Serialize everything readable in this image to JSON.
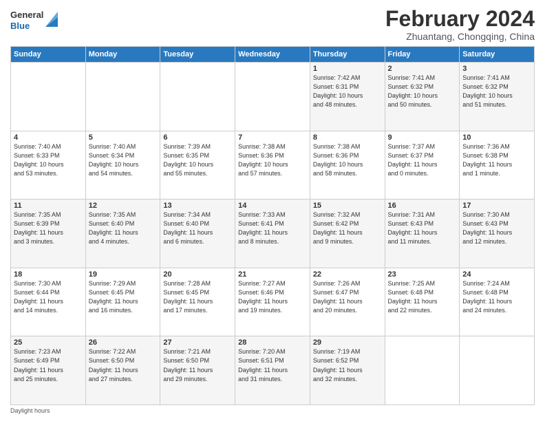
{
  "header": {
    "logo": {
      "general": "General",
      "blue": "Blue"
    },
    "title": "February 2024",
    "location": "Zhuantang, Chongqing, China"
  },
  "days_of_week": [
    "Sunday",
    "Monday",
    "Tuesday",
    "Wednesday",
    "Thursday",
    "Friday",
    "Saturday"
  ],
  "weeks": [
    [
      {
        "day": "",
        "info": ""
      },
      {
        "day": "",
        "info": ""
      },
      {
        "day": "",
        "info": ""
      },
      {
        "day": "",
        "info": ""
      },
      {
        "day": "1",
        "info": "Sunrise: 7:42 AM\nSunset: 6:31 PM\nDaylight: 10 hours\nand 48 minutes."
      },
      {
        "day": "2",
        "info": "Sunrise: 7:41 AM\nSunset: 6:32 PM\nDaylight: 10 hours\nand 50 minutes."
      },
      {
        "day": "3",
        "info": "Sunrise: 7:41 AM\nSunset: 6:32 PM\nDaylight: 10 hours\nand 51 minutes."
      }
    ],
    [
      {
        "day": "4",
        "info": "Sunrise: 7:40 AM\nSunset: 6:33 PM\nDaylight: 10 hours\nand 53 minutes."
      },
      {
        "day": "5",
        "info": "Sunrise: 7:40 AM\nSunset: 6:34 PM\nDaylight: 10 hours\nand 54 minutes."
      },
      {
        "day": "6",
        "info": "Sunrise: 7:39 AM\nSunset: 6:35 PM\nDaylight: 10 hours\nand 55 minutes."
      },
      {
        "day": "7",
        "info": "Sunrise: 7:38 AM\nSunset: 6:36 PM\nDaylight: 10 hours\nand 57 minutes."
      },
      {
        "day": "8",
        "info": "Sunrise: 7:38 AM\nSunset: 6:36 PM\nDaylight: 10 hours\nand 58 minutes."
      },
      {
        "day": "9",
        "info": "Sunrise: 7:37 AM\nSunset: 6:37 PM\nDaylight: 11 hours\nand 0 minutes."
      },
      {
        "day": "10",
        "info": "Sunrise: 7:36 AM\nSunset: 6:38 PM\nDaylight: 11 hours\nand 1 minute."
      }
    ],
    [
      {
        "day": "11",
        "info": "Sunrise: 7:35 AM\nSunset: 6:39 PM\nDaylight: 11 hours\nand 3 minutes."
      },
      {
        "day": "12",
        "info": "Sunrise: 7:35 AM\nSunset: 6:40 PM\nDaylight: 11 hours\nand 4 minutes."
      },
      {
        "day": "13",
        "info": "Sunrise: 7:34 AM\nSunset: 6:40 PM\nDaylight: 11 hours\nand 6 minutes."
      },
      {
        "day": "14",
        "info": "Sunrise: 7:33 AM\nSunset: 6:41 PM\nDaylight: 11 hours\nand 8 minutes."
      },
      {
        "day": "15",
        "info": "Sunrise: 7:32 AM\nSunset: 6:42 PM\nDaylight: 11 hours\nand 9 minutes."
      },
      {
        "day": "16",
        "info": "Sunrise: 7:31 AM\nSunset: 6:43 PM\nDaylight: 11 hours\nand 11 minutes."
      },
      {
        "day": "17",
        "info": "Sunrise: 7:30 AM\nSunset: 6:43 PM\nDaylight: 11 hours\nand 12 minutes."
      }
    ],
    [
      {
        "day": "18",
        "info": "Sunrise: 7:30 AM\nSunset: 6:44 PM\nDaylight: 11 hours\nand 14 minutes."
      },
      {
        "day": "19",
        "info": "Sunrise: 7:29 AM\nSunset: 6:45 PM\nDaylight: 11 hours\nand 16 minutes."
      },
      {
        "day": "20",
        "info": "Sunrise: 7:28 AM\nSunset: 6:45 PM\nDaylight: 11 hours\nand 17 minutes."
      },
      {
        "day": "21",
        "info": "Sunrise: 7:27 AM\nSunset: 6:46 PM\nDaylight: 11 hours\nand 19 minutes."
      },
      {
        "day": "22",
        "info": "Sunrise: 7:26 AM\nSunset: 6:47 PM\nDaylight: 11 hours\nand 20 minutes."
      },
      {
        "day": "23",
        "info": "Sunrise: 7:25 AM\nSunset: 6:48 PM\nDaylight: 11 hours\nand 22 minutes."
      },
      {
        "day": "24",
        "info": "Sunrise: 7:24 AM\nSunset: 6:48 PM\nDaylight: 11 hours\nand 24 minutes."
      }
    ],
    [
      {
        "day": "25",
        "info": "Sunrise: 7:23 AM\nSunset: 6:49 PM\nDaylight: 11 hours\nand 25 minutes."
      },
      {
        "day": "26",
        "info": "Sunrise: 7:22 AM\nSunset: 6:50 PM\nDaylight: 11 hours\nand 27 minutes."
      },
      {
        "day": "27",
        "info": "Sunrise: 7:21 AM\nSunset: 6:50 PM\nDaylight: 11 hours\nand 29 minutes."
      },
      {
        "day": "28",
        "info": "Sunrise: 7:20 AM\nSunset: 6:51 PM\nDaylight: 11 hours\nand 31 minutes."
      },
      {
        "day": "29",
        "info": "Sunrise: 7:19 AM\nSunset: 6:52 PM\nDaylight: 11 hours\nand 32 minutes."
      },
      {
        "day": "",
        "info": ""
      },
      {
        "day": "",
        "info": ""
      }
    ]
  ],
  "footer": {
    "note": "Daylight hours"
  }
}
